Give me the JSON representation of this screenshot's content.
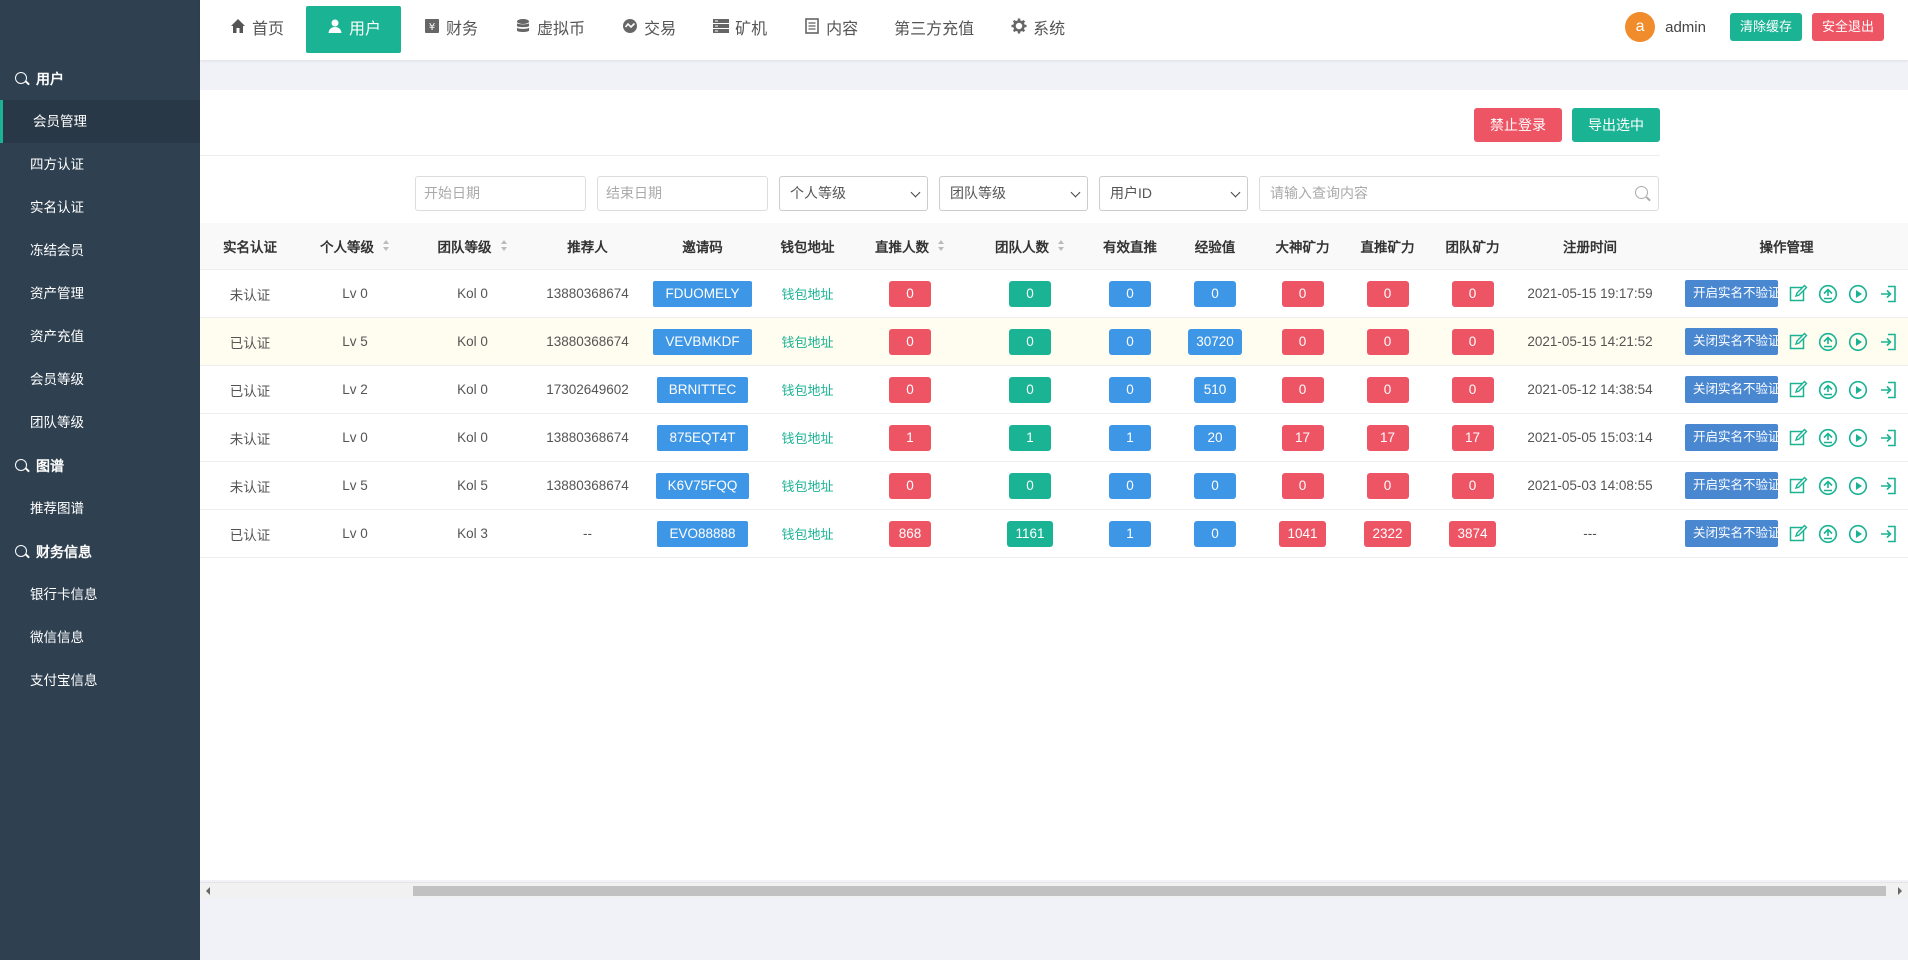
{
  "sidebar": {
    "groups": [
      {
        "label": "用户",
        "items": [
          "会员管理",
          "四方认证",
          "实名认证",
          "冻结会员",
          "资产管理",
          "资产充值",
          "会员等级",
          "团队等级"
        ]
      },
      {
        "label": "图谱",
        "items": [
          "推荐图谱"
        ]
      },
      {
        "label": "财务信息",
        "items": [
          "银行卡信息",
          "微信信息",
          "支付宝信息"
        ]
      }
    ],
    "active_item": "会员管理"
  },
  "nav": {
    "items": [
      {
        "label": "首页",
        "icon": "home-icon"
      },
      {
        "label": "用户",
        "icon": "user-icon"
      },
      {
        "label": "财务",
        "icon": "yen-icon"
      },
      {
        "label": "虚拟币",
        "icon": "database-icon"
      },
      {
        "label": "交易",
        "icon": "exchange-icon"
      },
      {
        "label": "矿机",
        "icon": "server-icon"
      },
      {
        "label": "内容",
        "icon": "document-icon"
      },
      {
        "label": "第三方充值",
        "icon": ""
      },
      {
        "label": "系统",
        "icon": "gear-icon"
      }
    ],
    "active": "用户"
  },
  "header": {
    "avatar_letter": "a",
    "username": "admin",
    "clear_cache": "清除缓存",
    "logout": "安全退出"
  },
  "toolbar": {
    "ban_login": "禁止登录",
    "export_selected": "导出选中"
  },
  "filters": {
    "start_date_placeholder": "开始日期",
    "end_date_placeholder": "结束日期",
    "personal_level": "个人等级",
    "team_level": "团队等级",
    "user_id": "用户ID",
    "search_placeholder": "请输入查询内容"
  },
  "table": {
    "columns": [
      "实名认证",
      "个人等级",
      "团队等级",
      "推荐人",
      "邀请码",
      "钱包地址",
      "直推人数",
      "团队人数",
      "有效直推",
      "经验值",
      "大神矿力",
      "直推矿力",
      "团队矿力",
      "注册时间",
      "操作管理"
    ],
    "rows": [
      {
        "verified": "未认证",
        "level": "Lv 0",
        "team": "Kol 0",
        "referrer": "13880368674",
        "code": "FDUOMELY",
        "wallet": "钱包地址",
        "direct": "0",
        "team_count": "0",
        "valid": "0",
        "exp": "0",
        "god": "0",
        "direct_power": "0",
        "team_power": "0",
        "time": "2021-05-15 19:17:59",
        "op": "开启实名不验证"
      },
      {
        "verified": "已认证",
        "level": "Lv 5",
        "team": "Kol 0",
        "referrer": "13880368674",
        "code": "VEVBMKDF",
        "wallet": "钱包地址",
        "direct": "0",
        "team_count": "0",
        "valid": "0",
        "exp": "30720",
        "god": "0",
        "direct_power": "0",
        "team_power": "0",
        "time": "2021-05-15 14:21:52",
        "op": "关闭实名不验证"
      },
      {
        "verified": "已认证",
        "level": "Lv 2",
        "team": "Kol 0",
        "referrer": "17302649602",
        "code": "BRNITTEC",
        "wallet": "钱包地址",
        "direct": "0",
        "team_count": "0",
        "valid": "0",
        "exp": "510",
        "god": "0",
        "direct_power": "0",
        "team_power": "0",
        "time": "2021-05-12 14:38:54",
        "op": "关闭实名不验证"
      },
      {
        "verified": "未认证",
        "level": "Lv 0",
        "team": "Kol 0",
        "referrer": "13880368674",
        "code": "875EQT4T",
        "wallet": "钱包地址",
        "direct": "1",
        "team_count": "1",
        "valid": "1",
        "exp": "20",
        "god": "17",
        "direct_power": "17",
        "team_power": "17",
        "time": "2021-05-05 15:03:14",
        "op": "开启实名不验证"
      },
      {
        "verified": "未认证",
        "level": "Lv 5",
        "team": "Kol 5",
        "referrer": "13880368674",
        "code": "K6V75FQQ",
        "wallet": "钱包地址",
        "direct": "0",
        "team_count": "0",
        "valid": "0",
        "exp": "0",
        "god": "0",
        "direct_power": "0",
        "team_power": "0",
        "time": "2021-05-03 14:08:55",
        "op": "开启实名不验证"
      },
      {
        "verified": "已认证",
        "level": "Lv 0",
        "team": "Kol 3",
        "referrer": "--",
        "code": "EVO88888",
        "wallet": "钱包地址",
        "direct": "868",
        "team_count": "1161",
        "valid": "1",
        "exp": "0",
        "god": "1041",
        "direct_power": "2322",
        "team_power": "3874",
        "time": "---",
        "op": "关闭实名不验证"
      }
    ]
  },
  "colors": {
    "sidebar_bg": "#2f4050",
    "accent_green": "#1ab394",
    "badge_red": "#ed5565",
    "badge_blue": "#3e96e6",
    "op_button": "#4a87d1"
  }
}
